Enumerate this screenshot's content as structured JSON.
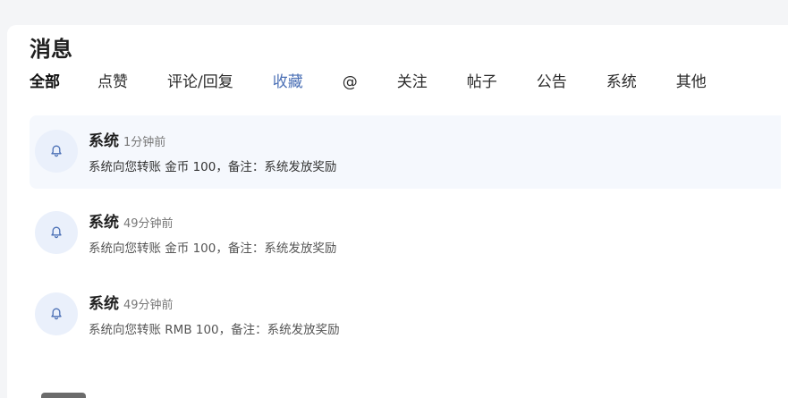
{
  "page": {
    "title": "消息"
  },
  "tabs": [
    {
      "label": "全部"
    },
    {
      "label": "点赞"
    },
    {
      "label": "评论/回复"
    },
    {
      "label": "收藏"
    },
    {
      "label": "@"
    },
    {
      "label": "关注"
    },
    {
      "label": "帖子"
    },
    {
      "label": "公告"
    },
    {
      "label": "系统"
    },
    {
      "label": "其他"
    }
  ],
  "messages": [
    {
      "sender": "系统",
      "time": "1分钟前",
      "body": "系统向您转账 金币 100，备注：系统发放奖励",
      "icon": "bell-icon"
    },
    {
      "sender": "系统",
      "time": "49分钟前",
      "body": "系统向您转账 金币 100，备注：系统发放奖励",
      "icon": "bell-icon"
    },
    {
      "sender": "系统",
      "time": "49分钟前",
      "body": "系统向您转账 RMB 100，备注：系统发放奖励",
      "icon": "bell-icon"
    }
  ],
  "colors": {
    "accent": "#4a6fb5",
    "highlight_bg": "#f5f8fd",
    "avatar_bg": "#eaf0fb"
  }
}
